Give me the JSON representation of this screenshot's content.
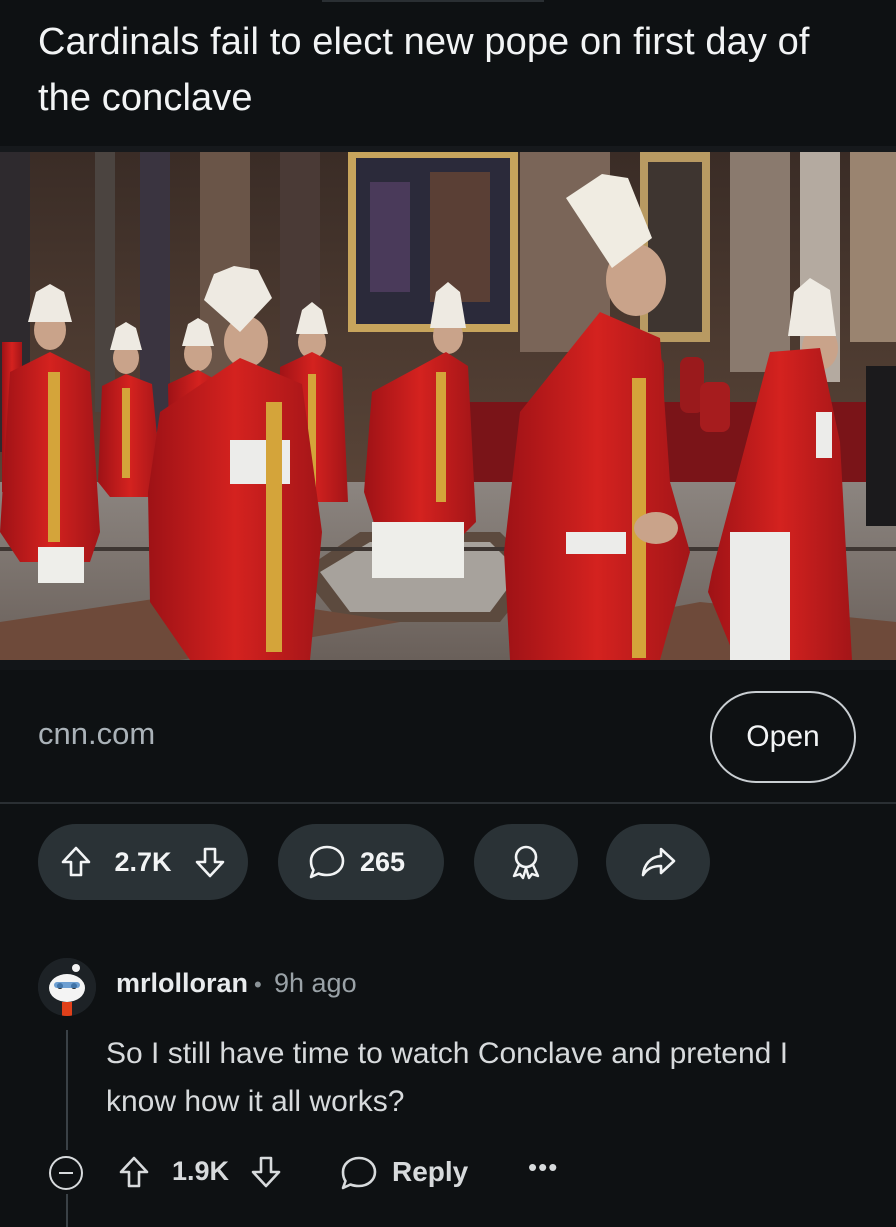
{
  "post": {
    "title": "Cardinals fail to elect new pope on first day of the conclave",
    "link_domain": "cnn.com",
    "open_label": "Open",
    "upvote_count": "2.7K",
    "comment_count": "265"
  },
  "comment": {
    "username": "mrlolloran",
    "separator": "•",
    "time_ago": "9h ago",
    "text": "So I still have time to watch Conclave and pretend I know how it all works?",
    "upvote_count": "1.9K",
    "reply_label": "Reply",
    "more_label": "•••"
  },
  "icons": {
    "upvote": "arrow-up-icon",
    "downvote": "arrow-down-icon",
    "comments": "speech-bubble-icon",
    "award": "award-icon",
    "share": "share-arrow-icon",
    "collapse": "collapse-minus-icon"
  },
  "colors": {
    "background": "#0e1113",
    "pill": "#2a3236",
    "robe_red": "#c8191e"
  }
}
